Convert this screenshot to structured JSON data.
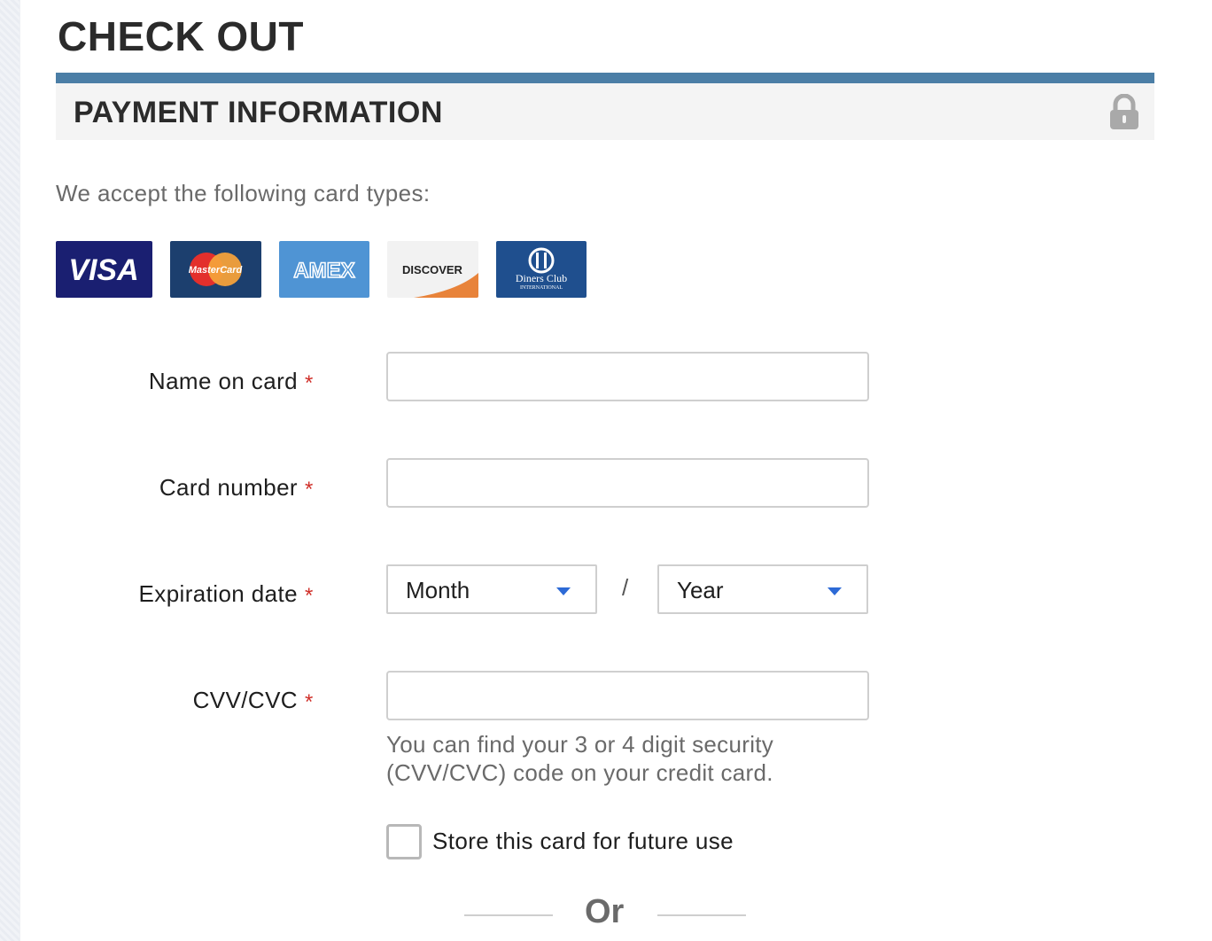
{
  "page": {
    "title": "CHECK OUT"
  },
  "payment": {
    "section_title": "PAYMENT INFORMATION",
    "accept_text": "We accept the following card types:",
    "cards": {
      "visa": "VISA",
      "mastercard": "MasterCard",
      "amex": "AMEX",
      "discover": "DISCOVER",
      "diners_line1": "Diners Club",
      "diners_line2": "INTERNATIONAL"
    }
  },
  "form": {
    "name_label": "Name on card",
    "name_value": "",
    "card_number_label": "Card number",
    "card_number_value": "",
    "expiration_label": "Expiration date",
    "month_selected": "Month",
    "date_separator": "/",
    "year_selected": "Year",
    "cvv_label": "CVV/CVC",
    "cvv_value": "",
    "cvv_help_line1": "You can find your 3 or 4 digit security",
    "cvv_help_line2": "(CVV/CVC) code on your credit card.",
    "required_mark": "*",
    "store_card_label": "Store this card for future use",
    "store_card_checked": false,
    "or_text": "Or"
  },
  "colors": {
    "header_bar": "#4b7ea6",
    "required": "#d0302a",
    "chevron": "#2d6ad6",
    "visa_bg": "#1a1f71",
    "mastercard_bg": "#1c3f6e",
    "amex_bg": "#4f94d4",
    "discover_orange": "#e8833a",
    "diners_bg": "#1f4f8e"
  },
  "icons": {
    "lock": "lock-icon",
    "dropdown": "chevron-down-icon"
  }
}
